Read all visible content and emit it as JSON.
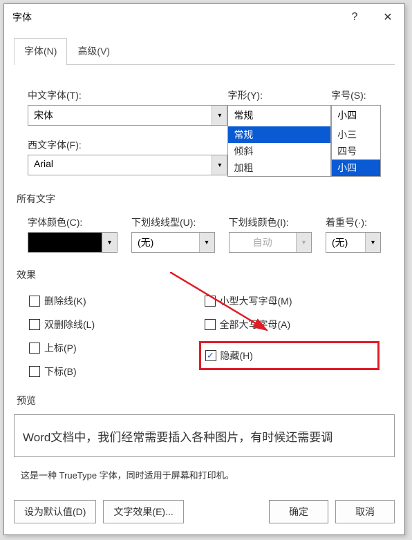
{
  "title": "字体",
  "tabs": {
    "font": "字体(N)",
    "advanced": "高级(V)"
  },
  "labels": {
    "cn_font": "中文字体(T):",
    "west_font": "西文字体(F):",
    "style": "字形(Y):",
    "size": "字号(S):",
    "all_text": "所有文字",
    "font_color": "字体颜色(C):",
    "underline_style": "下划线线型(U):",
    "underline_color": "下划线颜色(I):",
    "emphasis": "着重号(·):",
    "effects": "效果",
    "preview": "预览"
  },
  "values": {
    "cn_font": "宋体",
    "west_font": "Arial",
    "style": "常规",
    "size": "小四",
    "underline_style": "(无)",
    "underline_color": "自动",
    "emphasis": "(无)"
  },
  "style_options": [
    "常规",
    "倾斜",
    "加粗"
  ],
  "size_options": [
    "小三",
    "四号",
    "小四"
  ],
  "effects_left": [
    {
      "label": "删除线(K)",
      "checked": false
    },
    {
      "label": "双删除线(L)",
      "checked": false
    },
    {
      "label": "上标(P)",
      "checked": false
    },
    {
      "label": "下标(B)",
      "checked": false
    }
  ],
  "effects_right": [
    {
      "label": "小型大写字母(M)",
      "checked": false
    },
    {
      "label": "全部大写字母(A)",
      "checked": false
    },
    {
      "label": "隐藏(H)",
      "checked": true
    }
  ],
  "preview_text": "Word文档中，我们经常需要插入各种图片，有时候还需要调",
  "preview_note": "这是一种 TrueType 字体，同时适用于屏幕和打印机。",
  "buttons": {
    "default": "设为默认值(D)",
    "text_effects": "文字效果(E)...",
    "ok": "确定",
    "cancel": "取消"
  }
}
